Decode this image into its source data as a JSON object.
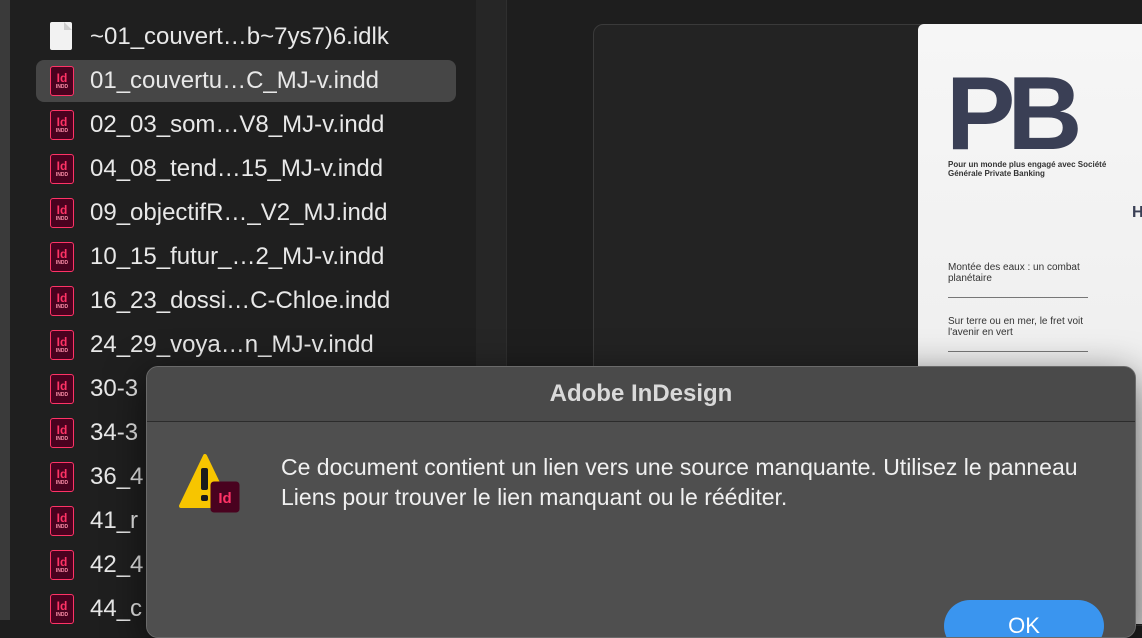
{
  "files": [
    {
      "name": "~01_couvert…b~7ys7)6.idlk",
      "type": "doc",
      "selected": false
    },
    {
      "name": "01_couvertu…C_MJ-v.indd",
      "type": "indd",
      "selected": true
    },
    {
      "name": "02_03_som…V8_MJ-v.indd",
      "type": "indd",
      "selected": false
    },
    {
      "name": "04_08_tend…15_MJ-v.indd",
      "type": "indd",
      "selected": false
    },
    {
      "name": "09_objectifR…_V2_MJ.indd",
      "type": "indd",
      "selected": false
    },
    {
      "name": "10_15_futur_…2_MJ-v.indd",
      "type": "indd",
      "selected": false
    },
    {
      "name": "16_23_dossi…C-Chloe.indd",
      "type": "indd",
      "selected": false
    },
    {
      "name": "24_29_voya…n_MJ-v.indd",
      "type": "indd",
      "selected": false
    },
    {
      "name": "30-3",
      "type": "indd",
      "selected": false
    },
    {
      "name": "34-3",
      "type": "indd",
      "selected": false
    },
    {
      "name": "36_4",
      "type": "indd",
      "selected": false
    },
    {
      "name": "41_r",
      "type": "indd",
      "selected": false
    },
    {
      "name": "42_4",
      "type": "indd",
      "selected": false
    },
    {
      "name": "44_c",
      "type": "indd",
      "selected": false
    }
  ],
  "icon_label": "Id",
  "icon_sublabel": "INDD",
  "preview": {
    "logo": "PB",
    "tagline": "Pour un monde plus engagé avec Société Générale Private Banking",
    "partial_heading": "H",
    "item1": "Montée des eaux : un combat planétaire",
    "item2": "Sur terre ou en mer, le fret voit l'avenir en vert"
  },
  "dialog": {
    "title": "Adobe InDesign",
    "message": "Ce document contient un lien vers une source manquante. Utilisez le panneau Liens pour trouver le lien manquant ou le rééditer.",
    "icon": "warning-indesign-icon",
    "ok_label": "OK"
  },
  "colors": {
    "accent": "#3a95ef",
    "indesign_pink": "#ff3366",
    "warning_yellow": "#f7c500"
  }
}
